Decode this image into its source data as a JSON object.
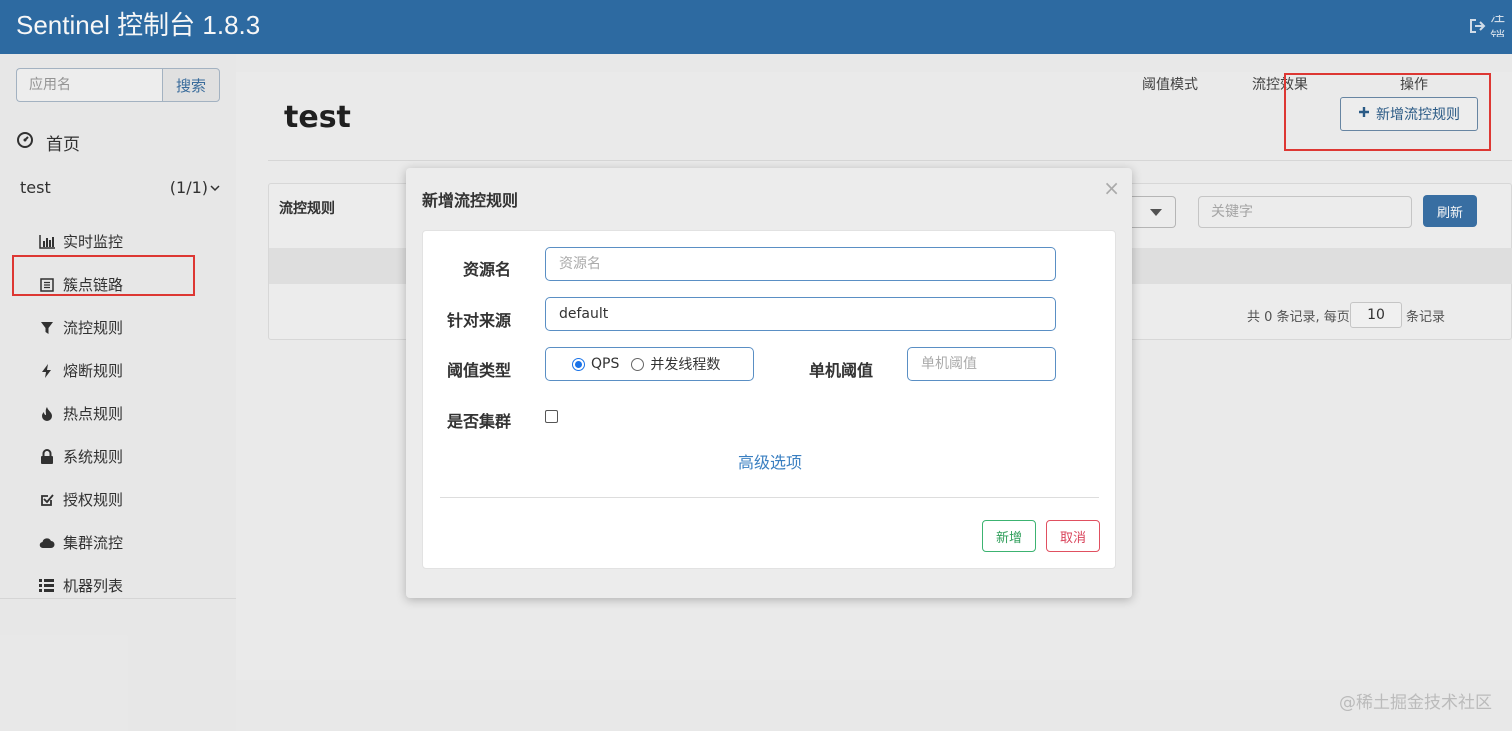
{
  "header": {
    "title": "Sentinel 控制台 1.8.3",
    "logout_label": "注销"
  },
  "sidebar": {
    "search_placeholder": "应用名",
    "search_button": "搜索",
    "home_label": "首页",
    "app_name": "test",
    "app_count": "(1/1)",
    "items": [
      {
        "label": "实时监控",
        "icon": "bar-chart-icon"
      },
      {
        "label": "簇点链路",
        "icon": "list-icon"
      },
      {
        "label": "流控规则",
        "icon": "filter-icon"
      },
      {
        "label": "熔断规则",
        "icon": "flash-icon"
      },
      {
        "label": "热点规则",
        "icon": "fire-icon"
      },
      {
        "label": "系统规则",
        "icon": "lock-icon"
      },
      {
        "label": "授权规则",
        "icon": "check-square-icon"
      },
      {
        "label": "集群流控",
        "icon": "cloud-icon"
      },
      {
        "label": "机器列表",
        "icon": "list-ul-icon"
      }
    ]
  },
  "main": {
    "title": "test",
    "add_rule_button": "新增流控规则",
    "card_label": "流控规则",
    "keyword_placeholder": "关键字",
    "refresh_button": "刷新",
    "columns": [
      "阈值模式",
      "流控效果",
      "操作"
    ],
    "pager": {
      "total_text": "共 0 条记录, 每页",
      "page_size": "10",
      "suffix": "条记录"
    }
  },
  "modal": {
    "title": "新增流控规则",
    "close": "×",
    "resource_label": "资源名",
    "resource_placeholder": "资源名",
    "origin_label": "针对来源",
    "origin_value": "default",
    "threshold_type_label": "阈值类型",
    "threshold_options": [
      "QPS",
      "并发线程数"
    ],
    "threshold_selected": "QPS",
    "single_threshold_label": "单机阈值",
    "single_threshold_placeholder": "单机阈值",
    "cluster_label": "是否集群",
    "advanced_link": "高级选项",
    "add_button": "新增",
    "cancel_button": "取消"
  },
  "watermark": "@稀土掘金技术社区",
  "colors": {
    "header": "#2f6ea7",
    "accent": "#3a72a8",
    "highlight": "#e53935",
    "success": "#2e9e5a",
    "danger": "#d9435a"
  }
}
